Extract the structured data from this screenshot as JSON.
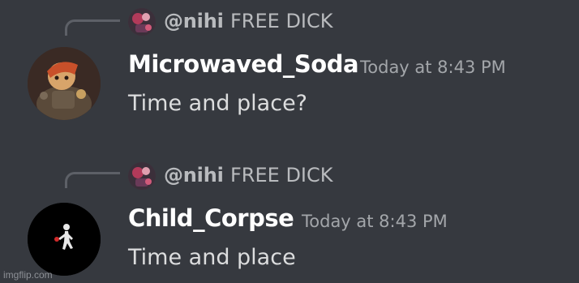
{
  "messages": [
    {
      "reply": {
        "author": "@nihi",
        "text": "FREE DICK",
        "avatar_icon": "nihi-avatar"
      },
      "author": "Microwaved_Soda",
      "timestamp": "Today at 8:43 PM",
      "content": "Time and place?",
      "avatar_icon": "microwaved-soda-avatar"
    },
    {
      "reply": {
        "author": "@nihi",
        "text": "FREE DICK",
        "avatar_icon": "nihi-avatar"
      },
      "author": "Child_Corpse",
      "timestamp": "Today at 8:43 PM",
      "content": "Time and place",
      "avatar_icon": "child-corpse-avatar"
    }
  ],
  "watermark": "imgflip.com",
  "colors": {
    "background": "#36393f",
    "author": "#ffffff",
    "timestamp": "#a3a6aa",
    "content": "#dcddde",
    "reply": "#b9bbbe"
  }
}
